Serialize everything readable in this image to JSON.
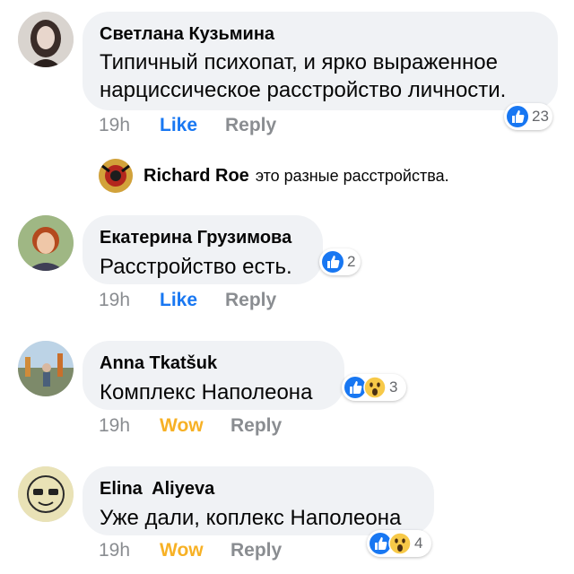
{
  "comments": [
    {
      "author": "Светлана Кузьмина",
      "text_line1": "Типичный психопат, и ярко выраженное",
      "text_line2": "нарциссическое расстройство личности.",
      "time": "19h",
      "react_label": "Like",
      "reply_label": "Reply",
      "reaction_count": "23",
      "reaction_icons": [
        "like-icon"
      ]
    },
    {
      "author": "Екатерина Грузимова",
      "text": "Расстройство есть.",
      "time": "19h",
      "react_label": "Like",
      "reply_label": "Reply",
      "reaction_count": "2",
      "reaction_icons": [
        "like-icon"
      ]
    },
    {
      "author": "Anna Tkatšuk",
      "text": "Комплекс Наполеона",
      "time": "19h",
      "react_label": "Wow",
      "reply_label": "Reply",
      "reaction_count": "3",
      "reaction_icons": [
        "like-icon",
        "wow-icon"
      ]
    },
    {
      "author": "Elina  Aliyeva",
      "text": "Уже дали, коплекс Наполеона",
      "time": "19h",
      "react_label": "Wow",
      "reply_label": "Reply",
      "reaction_count": "4",
      "reaction_icons": [
        "like-icon",
        "wow-icon"
      ]
    }
  ],
  "reply": {
    "author": "Richard Roe",
    "text": "это разные расстройства."
  },
  "colors": {
    "bubble": "#f0f2f5",
    "like_blue": "#1877f2",
    "wow_yellow": "#f7b125",
    "meta_gray": "#8a8d91"
  }
}
